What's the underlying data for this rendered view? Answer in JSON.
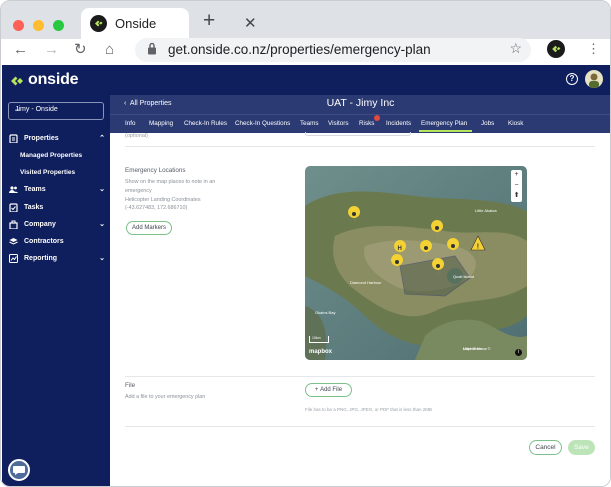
{
  "browser": {
    "tab_title": "Onside",
    "tab_close_glyph": "✕",
    "new_tab_glyph": "+",
    "url": "get.onside.co.nz/properties/emergency-plan",
    "back_glyph": "←",
    "forward_glyph": "→",
    "reload_glyph": "↻",
    "home_glyph": "⌂",
    "star_glyph": "☆",
    "menu_glyph": "⋮"
  },
  "app": {
    "logo_text": "onside",
    "help_glyph": "?",
    "brand_color": "#0f1e5c",
    "accent_color": "#b6e35c"
  },
  "sidebar": {
    "org_name": "Jimy - Onside",
    "items": [
      {
        "label": "Properties",
        "icon": "clipboard-icon",
        "chevron": "⌃"
      },
      {
        "label": "Teams",
        "icon": "users-icon",
        "chevron": "⌄"
      },
      {
        "label": "Tasks",
        "icon": "checklist-icon",
        "chevron": ""
      },
      {
        "label": "Company",
        "icon": "company-icon",
        "chevron": "⌄"
      },
      {
        "label": "Contractors",
        "icon": "layers-icon",
        "chevron": ""
      },
      {
        "label": "Reporting",
        "icon": "chart-icon",
        "chevron": "⌄"
      }
    ],
    "sub_items": [
      "Managed Properties",
      "Visited Properties"
    ]
  },
  "header": {
    "back_label": "All Properties",
    "title": "UAT - Jimy Inc"
  },
  "property_tabs": [
    "Info",
    "Mapping",
    "Check-In Rules",
    "Check-In Questions",
    "Teams",
    "Visitors",
    "Risks",
    "Incidents",
    "Emergency Plan",
    "Jobs",
    "Kiosk"
  ],
  "active_tab": "Emergency Plan",
  "main": {
    "optional_label": "(optional)",
    "locations": {
      "title": "Emergency Locations",
      "description": "Show on the map places to note in an emergency",
      "coords_label": "Helicopter Landing Coordinates",
      "coords_value": "(-43.627483, 172.686710)",
      "add_markers_label": "Add Markers"
    },
    "map": {
      "zoom_in": "+",
      "zoom_out": "−",
      "compass": "⬆",
      "scale_label": "10km",
      "mapbox_label": "mapbox",
      "attribution": "Mapbox Maxar ©",
      "info_glyph": "i",
      "place_labels": [
        "Little Akaloa",
        "Diamond Harbour",
        "Quail Island",
        "Okains Bay",
        "Little River"
      ]
    },
    "file": {
      "title": "File",
      "description": "Add a file to your emergency plan",
      "add_file_label": "Add File",
      "hint": "File has to be a PNG, JPG, JPEG, or PDF that is less than 2MB"
    },
    "cancel_label": "Cancel",
    "save_label": "Save"
  }
}
